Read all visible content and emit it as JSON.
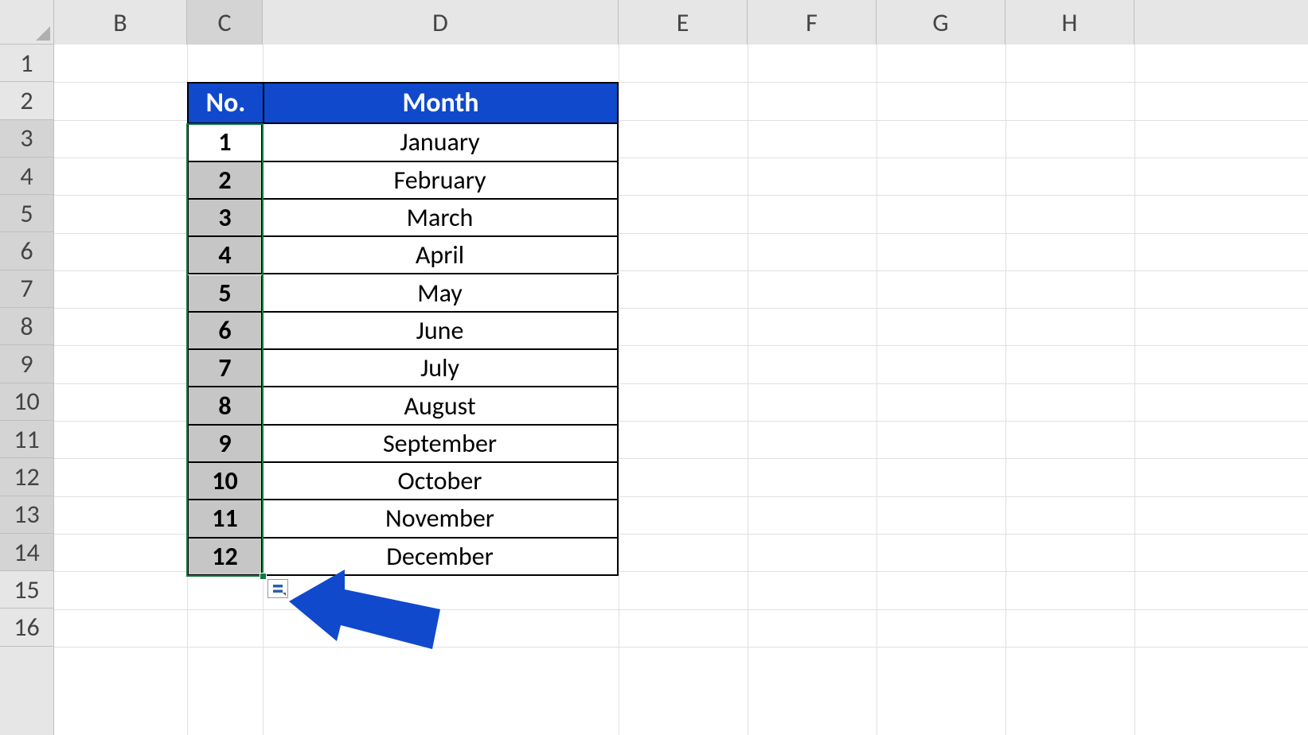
{
  "columns": [
    "B",
    "C",
    "D",
    "E",
    "F",
    "G",
    "H"
  ],
  "rows": [
    "1",
    "2",
    "3",
    "4",
    "5",
    "6",
    "7",
    "8",
    "9",
    "10",
    "11",
    "12",
    "13",
    "14",
    "15",
    "16"
  ],
  "selected_column": "C",
  "selected_rows_start": 3,
  "selected_rows_end": 14,
  "table": {
    "headers": {
      "no": "No.",
      "month": "Month"
    },
    "data": [
      {
        "no": "1",
        "month": "January"
      },
      {
        "no": "2",
        "month": "February"
      },
      {
        "no": "3",
        "month": "March"
      },
      {
        "no": "4",
        "month": "April"
      },
      {
        "no": "5",
        "month": "May"
      },
      {
        "no": "6",
        "month": "June"
      },
      {
        "no": "7",
        "month": "July"
      },
      {
        "no": "8",
        "month": "August"
      },
      {
        "no": "9",
        "month": "September"
      },
      {
        "no": "10",
        "month": "October"
      },
      {
        "no": "11",
        "month": "November"
      },
      {
        "no": "12",
        "month": "December"
      }
    ]
  },
  "colors": {
    "header_bg": "#1049cc",
    "header_fg": "#ffffff",
    "selection_border": "#0e7a3f",
    "selected_fill": "#c6c6c6",
    "arrow": "#1049cc"
  }
}
